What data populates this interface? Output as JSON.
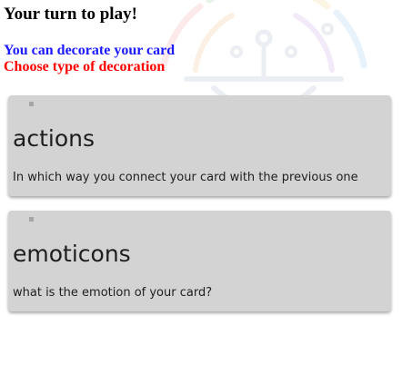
{
  "page": {
    "title": "Your turn to play!",
    "subtitle": "You can decorate your card",
    "instruction": "Choose type of decoration"
  },
  "options": [
    {
      "title": "actions",
      "description": "In which way you connect your card with the previous one"
    },
    {
      "title": "emoticons",
      "description": "what is the emotion of your card?"
    }
  ],
  "colors": {
    "subtitle": "#1a1aff",
    "instruction": "#ff0000",
    "card_background": "#d3d3d3"
  },
  "icons": {
    "watermark": "circuit-logo-icon"
  }
}
